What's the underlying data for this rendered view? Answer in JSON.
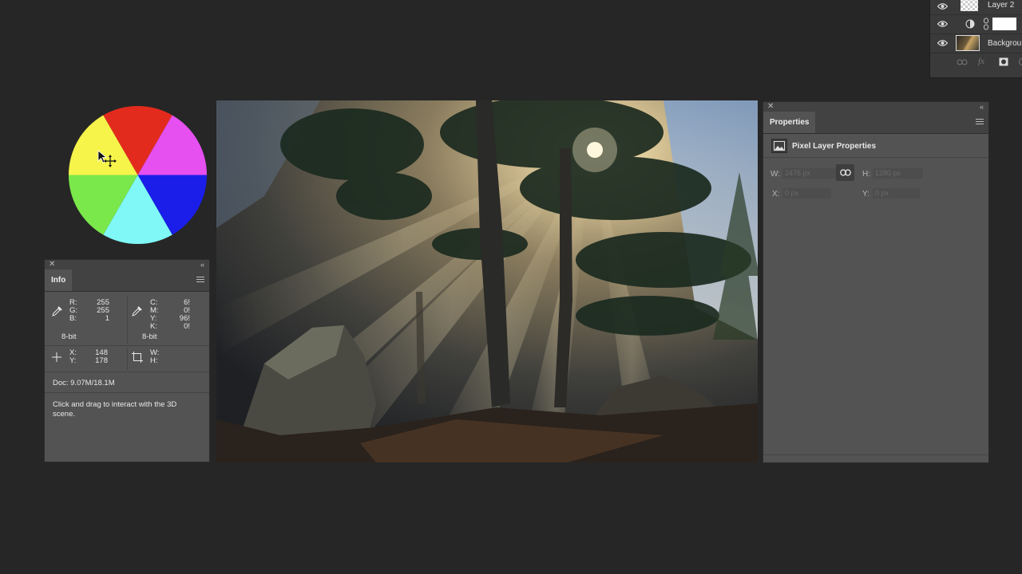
{
  "layers": {
    "items": [
      {
        "name": "Layer 2"
      },
      {
        "name": ""
      },
      {
        "name": "Background"
      }
    ]
  },
  "info": {
    "title": "Info",
    "rgb": {
      "r_label": "R:",
      "r": "255",
      "g_label": "G:",
      "g": "255",
      "b_label": "B:",
      "b": "1",
      "bit": "8-bit"
    },
    "cmyk": {
      "c_label": "C:",
      "c": "6!",
      "m_label": "M:",
      "m": "0!",
      "y_label": "Y:",
      "y": "96!",
      "k_label": "K:",
      "k": "0!",
      "bit": "8-bit"
    },
    "xy": {
      "x_label": "X:",
      "x": "148",
      "y_label": "Y:",
      "y": "178"
    },
    "wh": {
      "w_label": "W:",
      "h_label": "H:"
    },
    "doc": "Doc: 9.07M/18.1M",
    "hint": "Click and drag to interact with the 3D scene."
  },
  "properties": {
    "title": "Properties",
    "subtitle": "Pixel Layer Properties",
    "w_label": "W:",
    "w_value": "2476 px",
    "h_label": "H:",
    "h_value": "1280 px",
    "x_label": "X:",
    "x_value": "0 px",
    "y_label": "Y:",
    "y_value": "0 px"
  },
  "colors": {
    "wheel": [
      "#e32b1d",
      "#e64ff0",
      "#1a1ee8",
      "#7ff8f7",
      "#7ae84a",
      "#f6f34a"
    ]
  }
}
